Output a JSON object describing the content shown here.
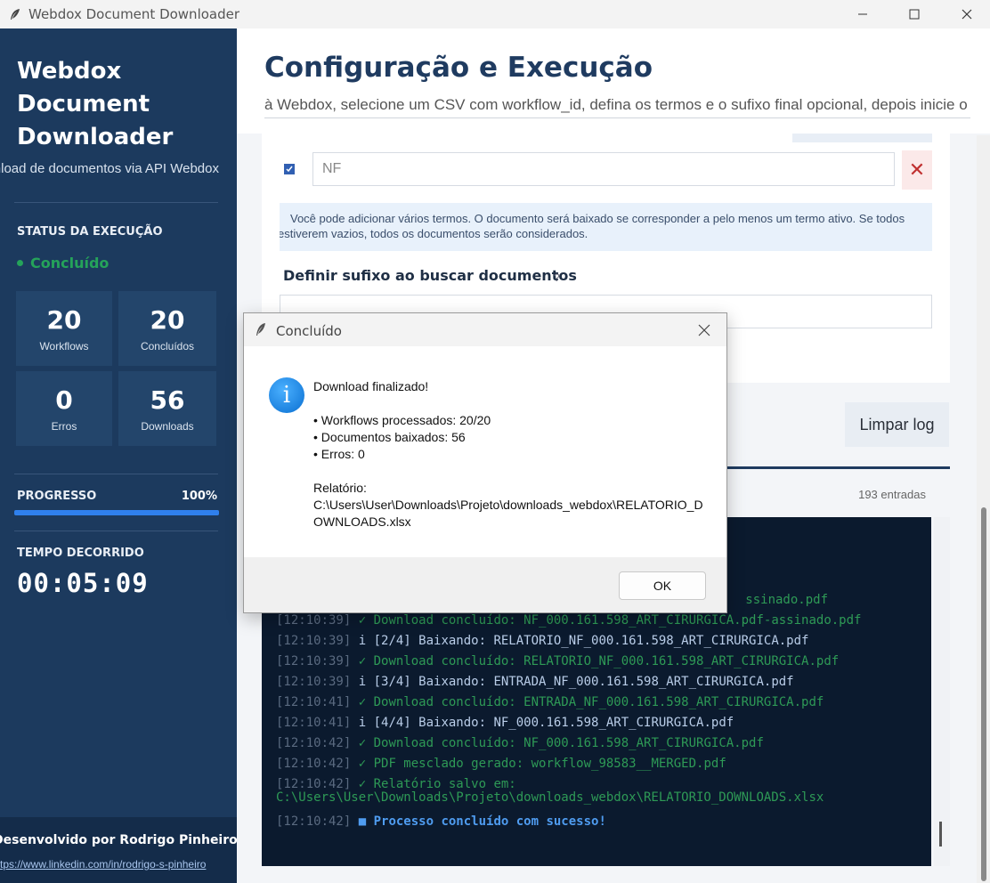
{
  "window": {
    "title": "Webdox Document Downloader"
  },
  "sidebar": {
    "title": "Webdox Document Downloader",
    "subtitle": "Download de documentos via API Webdox",
    "status_label": "STATUS DA EXECUÇÃO",
    "status_value": "Concluído",
    "status_color": "#25a35a",
    "stats": [
      {
        "value": "20",
        "label": "Workflows"
      },
      {
        "value": "20",
        "label": "Concluídos"
      },
      {
        "value": "0",
        "label": "Erros"
      },
      {
        "value": "56",
        "label": "Downloads"
      }
    ],
    "progress_label": "PROGRESSO",
    "progress_pct": "100%",
    "progress_fraction": 1.0,
    "time_label": "TEMPO DECORRIDO",
    "time_value": "00:05:09",
    "developer": "Desenvolvido por Rodrigo Pinheiro",
    "link": "https://www.linkedin.com/in/rodrigo-s-pinheiro"
  },
  "main": {
    "title": "Configuração e Execução",
    "description": "à Webdox, selecione um CSV com workflow_id, defina os termos e o sufixo final opcional, depois inicie o",
    "term_value": "NF",
    "delete_symbol": "✕",
    "info_line1": "Você pode adicionar vários termos. O documento será baixado se corresponder a pelo menos um termo ativo. Se todos",
    "info_line2": "estiverem vazios, todos os documentos serão considerados.",
    "suffix_label": "Definir sufixo ao buscar documentos",
    "help_symbol": "?",
    "clear_log": "Limpar log",
    "log_count": "193 entradas"
  },
  "log": [
    {
      "ts": "",
      "text": "ssinado.pdf",
      "kind": "ok"
    },
    {
      "ts": "[12:10:39]",
      "text": "✓ Download concluído: NF_000.161.598_ART_CIRURGICA.pdf-assinado.pdf",
      "kind": "ok"
    },
    {
      "ts": "[12:10:39]",
      "text": "i [2/4] Baixando: RELATORIO_NF_000.161.598_ART_CIRURGICA.pdf",
      "kind": "info"
    },
    {
      "ts": "[12:10:39]",
      "text": "✓ Download concluído: RELATORIO_NF_000.161.598_ART_CIRURGICA.pdf",
      "kind": "ok"
    },
    {
      "ts": "[12:10:39]",
      "text": "i [3/4] Baixando: ENTRADA_NF_000.161.598_ART_CIRURGICA.pdf",
      "kind": "info"
    },
    {
      "ts": "[12:10:41]",
      "text": "✓ Download concluído: ENTRADA_NF_000.161.598_ART_CIRURGICA.pdf",
      "kind": "ok"
    },
    {
      "ts": "[12:10:41]",
      "text": "i [4/4] Baixando: NF_000.161.598_ART_CIRURGICA.pdf",
      "kind": "info"
    },
    {
      "ts": "[12:10:42]",
      "text": "✓ Download concluído: NF_000.161.598_ART_CIRURGICA.pdf",
      "kind": "ok"
    },
    {
      "ts": "[12:10:42]",
      "text": "✓ PDF mesclado gerado: workflow_98583__MERGED.pdf",
      "kind": "ok"
    },
    {
      "ts": "[12:10:42]",
      "text": "✓ Relatório salvo em:",
      "kind": "ok"
    },
    {
      "ts": "",
      "text": "C:\\Users\\User\\Downloads\\Projeto\\downloads_webdox\\RELATORIO_DOWNLOADS.xlsx",
      "kind": "ok"
    },
    {
      "ts": "[12:10:42]",
      "text": "■ Processo concluído com sucesso!",
      "kind": "done"
    }
  ],
  "dialog": {
    "title": "Concluído",
    "heading": "Download finalizado!",
    "workflows": "• Workflows processados: 20/20",
    "documents": "• Documentos baixados: 56",
    "errors": "• Erros: 0",
    "report_label": "Relatório:",
    "report_path_1": "C:\\Users\\User\\Downloads\\Projeto\\downloads_webdox\\RELATORIO_D",
    "report_path_2": "OWNLOADS.xlsx",
    "ok_label": "OK",
    "icon_glyph": "i"
  }
}
